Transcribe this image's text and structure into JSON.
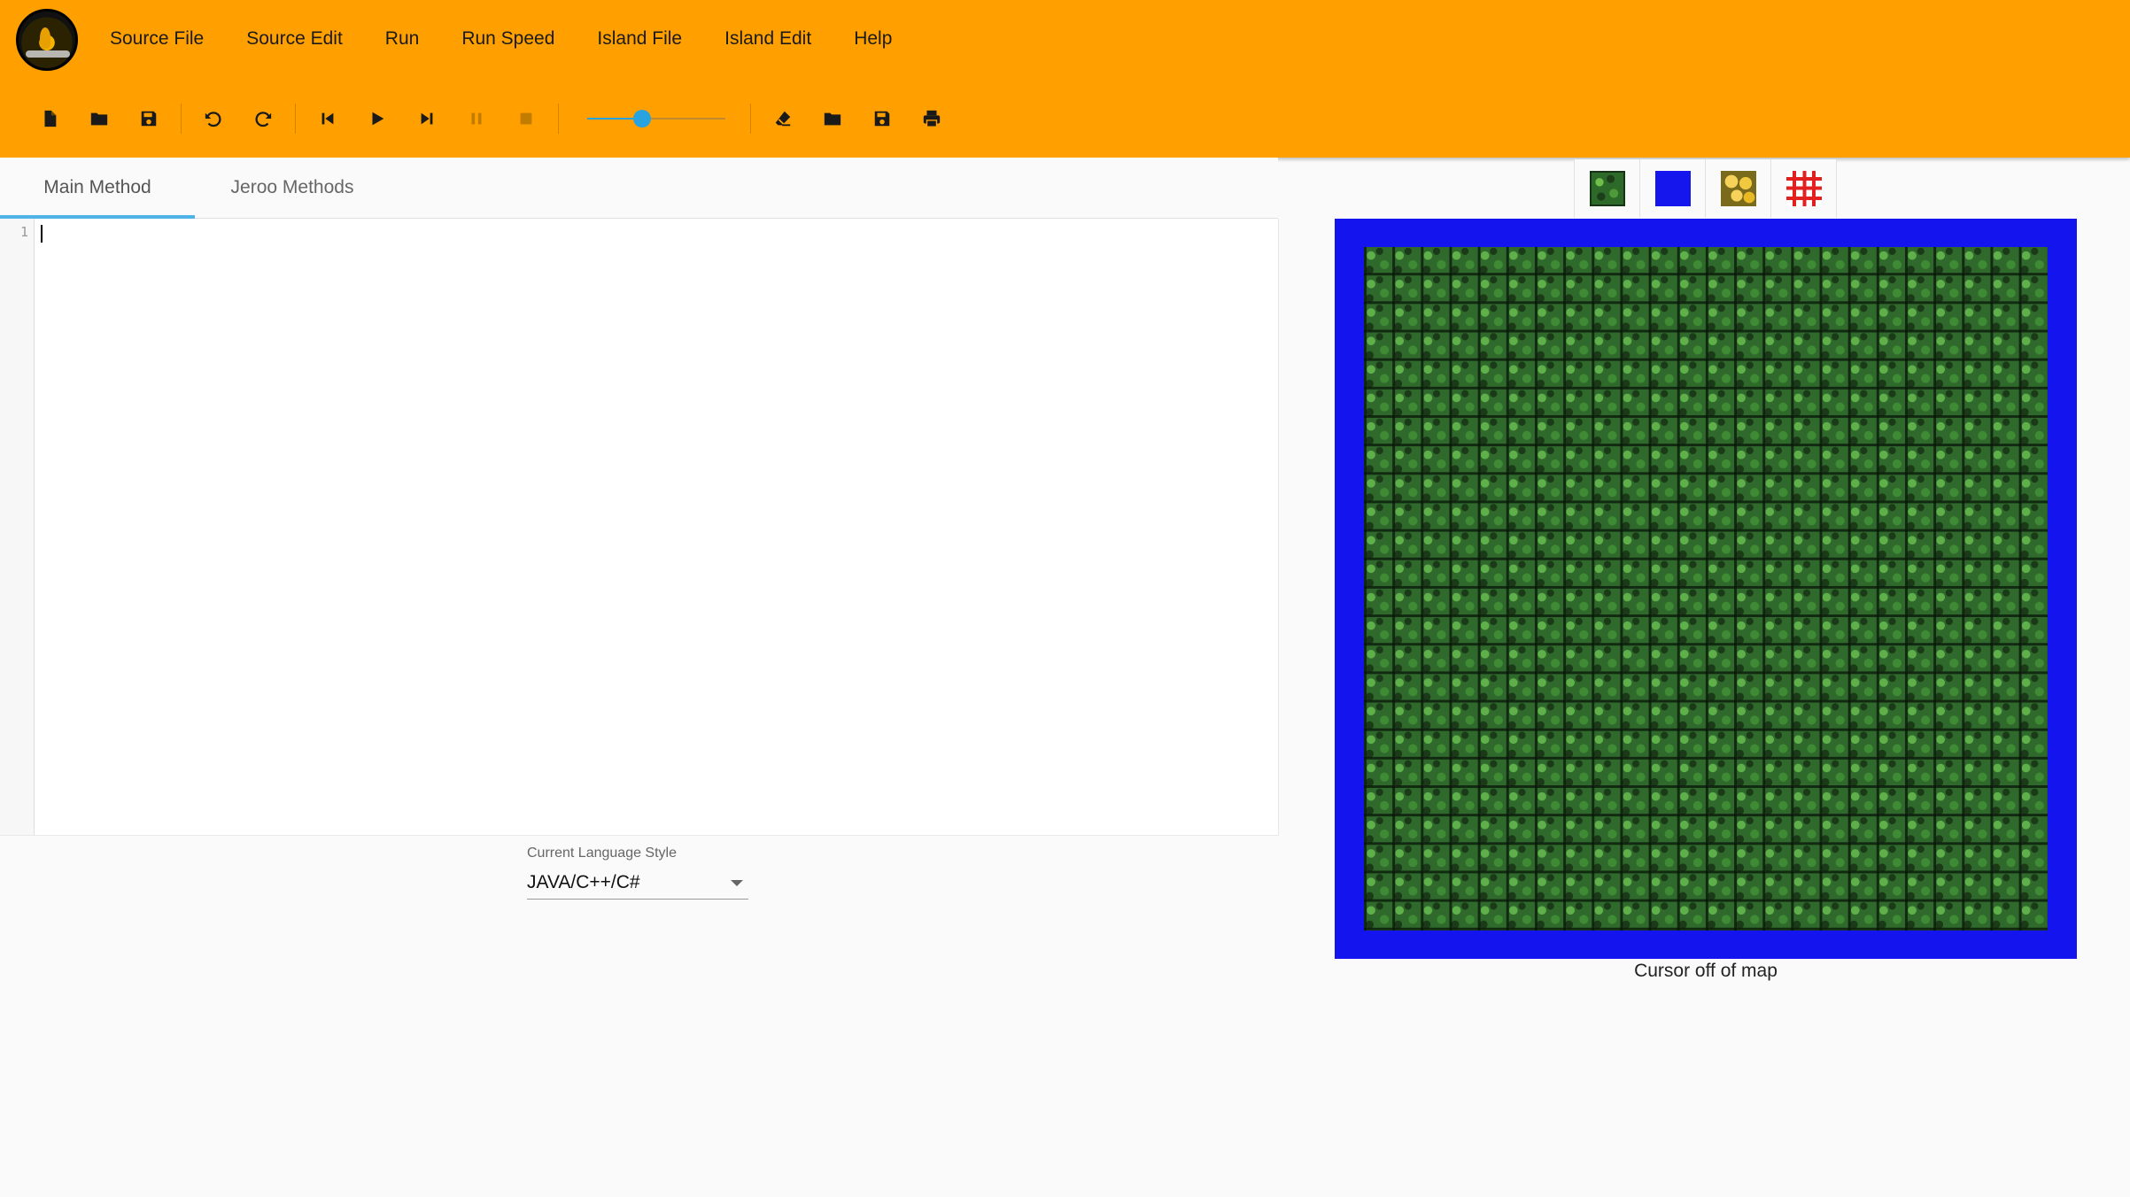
{
  "app": {
    "logo_name": "jeroo-logo"
  },
  "menu": {
    "items": [
      "Source File",
      "Source Edit",
      "Run",
      "Run Speed",
      "Island File",
      "Island Edit",
      "Help"
    ]
  },
  "toolbar": {
    "source_buttons": [
      "new-file-icon",
      "open-folder-icon",
      "save-icon"
    ],
    "edit_buttons": [
      "undo-icon",
      "redo-icon"
    ],
    "run_buttons": [
      "reset-icon",
      "run-icon",
      "step-icon",
      "pause-icon",
      "stop-icon"
    ],
    "run_speed": 0.4,
    "island_buttons": [
      "eraser-icon",
      "open-island-icon",
      "save-island-icon",
      "print-icon"
    ]
  },
  "tabs": [
    {
      "label": "Main Method",
      "active": true
    },
    {
      "label": "Jeroo Methods",
      "active": false
    }
  ],
  "editor": {
    "line_numbers": [
      "1"
    ],
    "content": ""
  },
  "language": {
    "label": "Current Language Style",
    "value": "JAVA/C++/C#"
  },
  "palette": {
    "tiles": [
      "grass-tile-icon",
      "water-tile-icon",
      "flower-tile-icon",
      "net-tile-icon"
    ]
  },
  "map": {
    "status": "Cursor off of map",
    "colors": {
      "water": "#1414ee",
      "land": "#2f6a2c"
    }
  },
  "colors": {
    "appbar": "#ffa000",
    "accent": "#4fb3e8"
  }
}
